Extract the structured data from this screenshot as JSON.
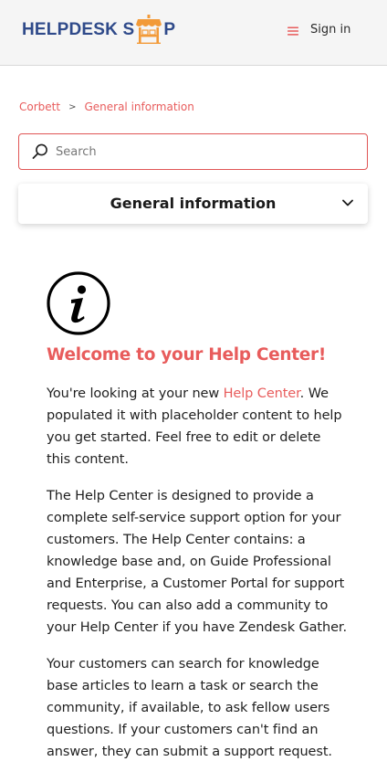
{
  "header": {
    "logo": {
      "text_left": "HELPDESK S",
      "text_right": "P"
    },
    "signin_label": "Sign in"
  },
  "breadcrumb": {
    "items": [
      "Corbett",
      "General information"
    ],
    "separator": ">"
  },
  "search": {
    "placeholder": "Search",
    "value": ""
  },
  "section": {
    "title": "General information"
  },
  "article": {
    "title": "Welcome to your Help Center!",
    "p1_before": "You're looking at your new ",
    "p1_link": "Help Center",
    "p1_after": ". We populated it with placeholder content to help you get started. Feel free to edit or delete this content.",
    "p2": "The Help Center is designed to provide a complete self-service support option for your customers. The Help Center contains: a knowledge base and, on Guide Professional and Enterprise, a Customer Portal for support requests. You can also add a community to your Help Center if you have Zendesk Gather.",
    "p3": "Your customers can search for knowledge base articles to learn a task or search the community, if available, to ask fellow users questions. If your customers can't find an answer, they can submit a support request."
  },
  "colors": {
    "accent": "#e85c5c",
    "logo_blue": "#2f4a8a",
    "logo_orange": "#f29a38",
    "header_bg": "#f5f5f5"
  },
  "icons": {
    "menu": "hamburger-icon",
    "search": "search-icon",
    "chevron": "chevron-down-icon",
    "info": "info-icon",
    "logo_mark": "shop-stall-icon"
  }
}
